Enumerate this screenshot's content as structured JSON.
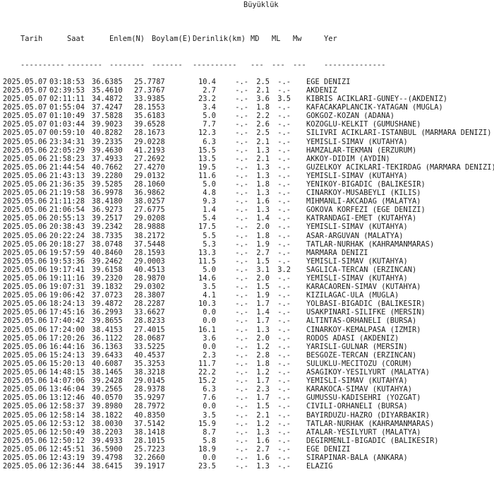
{
  "header": {
    "group_title": "Büyüklük",
    "columns": [
      "Tarih",
      "Saat",
      "Enlem(N)",
      "Boylam(E)",
      "Derinlik(km)",
      "MD",
      "ML",
      "Mw",
      "Yer"
    ],
    "separators": [
      "----------",
      "--------",
      "--------",
      "-------",
      "----------",
      "---",
      "---",
      "---",
      "--------------"
    ]
  },
  "rows": [
    [
      "2025.05.07",
      "03:18:53",
      "36.6385",
      "25.7787",
      "10.4",
      "-.-",
      "2.5",
      "-.-",
      "EGE DENIZI"
    ],
    [
      "2025.05.07",
      "02:39:53",
      "35.4610",
      "27.3767",
      "2.7",
      "-.-",
      "2.1",
      "-.-",
      "AKDENIZ"
    ],
    [
      "2025.05.07",
      "02:11:11",
      "34.4872",
      "33.9385",
      "23.2",
      "-.-",
      "3.6",
      "3.5",
      "KIBRIS ACIKLARI-GUNEY--(AKDENIZ)"
    ],
    [
      "2025.05.07",
      "01:55:04",
      "37.4247",
      "28.1553",
      "3.4",
      "-.-",
      "1.8",
      "-.-",
      "KAFACAKAPLANCIK-YATAGAN (MUGLA)"
    ],
    [
      "2025.05.07",
      "01:10:49",
      "37.5828",
      "35.6183",
      "5.0",
      "-.-",
      "2.2",
      "-.-",
      "GOKGOZ-KOZAN (ADANA)"
    ],
    [
      "2025.05.07",
      "01:03:44",
      "39.9023",
      "39.6528",
      "7.7",
      "-.-",
      "2.6",
      "-.-",
      "KOZOGLU-KELKIT (GUMUSHANE)"
    ],
    [
      "2025.05.07",
      "00:59:10",
      "40.8282",
      "28.1673",
      "12.3",
      "-.-",
      "2.5",
      "-.-",
      "SILIVRI ACIKLARI-ISTANBUL (MARMARA DENIZI)"
    ],
    [
      "2025.05.06",
      "23:34:31",
      "39.2335",
      "29.0228",
      "6.3",
      "-.-",
      "2.1",
      "-.-",
      "YEMISLI-SIMAV (KUTAHYA)"
    ],
    [
      "2025.05.06",
      "22:05:29",
      "39.4630",
      "41.2193",
      "15.5",
      "-.-",
      "1.3",
      "-.-",
      "HAMZALAR-TEKMAN (ERZURUM)"
    ],
    [
      "2025.05.06",
      "21:58:23",
      "37.4933",
      "27.2692",
      "13.5",
      "-.-",
      "2.1",
      "-.-",
      "AKKOY-DIDIM (AYDIN)"
    ],
    [
      "2025.05.06",
      "21:44:54",
      "40.7662",
      "27.4270",
      "19.5",
      "-.-",
      "1.3",
      "-.-",
      "GUZELKOY ACIKLARI-TEKIRDAG (MARMARA DENIZI)"
    ],
    [
      "2025.05.06",
      "21:43:13",
      "39.2280",
      "29.0132",
      "11.6",
      "-.-",
      "1.3",
      "-.-",
      "YEMISLI-SIMAV (KUTAHYA)"
    ],
    [
      "2025.05.06",
      "21:36:35",
      "39.5285",
      "28.1060",
      "5.0",
      "-.-",
      "1.8",
      "-.-",
      "YENIKOY-BIGADIC (BALIKESIR)"
    ],
    [
      "2025.05.06",
      "21:19:58",
      "36.9978",
      "36.9862",
      "4.8",
      "-.-",
      "1.3",
      "-.-",
      "CINARKOY-MUSABEYLI (KILIS)"
    ],
    [
      "2025.05.06",
      "21:11:28",
      "38.4180",
      "38.0257",
      "9.3",
      "-.-",
      "1.6",
      "-.-",
      "MIHMANLI-AKCADAG (MALATYA)"
    ],
    [
      "2025.05.06",
      "21:06:54",
      "36.9273",
      "27.6775",
      "1.4",
      "-.-",
      "1.3",
      "-.-",
      "GOKOVA KORFEZI (EGE DENIZI)"
    ],
    [
      "2025.05.06",
      "20:55:13",
      "39.2517",
      "29.0208",
      "5.4",
      "-.-",
      "1.4",
      "-.-",
      "KATRANDAGI-EMET (KUTAHYA)"
    ],
    [
      "2025.05.06",
      "20:38:43",
      "39.2342",
      "28.9888",
      "17.5",
      "-.-",
      "2.0",
      "-.-",
      "YEMISLI-SIMAV (KUTAHYA)"
    ],
    [
      "2025.05.06",
      "20:22:24",
      "38.7335",
      "38.2172",
      "5.5",
      "-.-",
      "1.8",
      "-.-",
      "ASAR-ARGUVAN (MALATYA)"
    ],
    [
      "2025.05.06",
      "20:18:27",
      "38.0748",
      "37.5448",
      "5.3",
      "-.-",
      "1.9",
      "-.-",
      "TATLAR-NURHAK (KAHRAMANMARAS)"
    ],
    [
      "2025.05.06",
      "19:57:59",
      "40.8460",
      "28.1593",
      "13.3",
      "-.-",
      "2.7",
      "-.-",
      "MARMARA DENIZI"
    ],
    [
      "2025.05.06",
      "19:53:36",
      "39.2462",
      "29.0003",
      "11.5",
      "-.-",
      "1.5",
      "-.-",
      "YEMISLI-SIMAV (KUTAHYA)"
    ],
    [
      "2025.05.06",
      "19:17:41",
      "39.6158",
      "40.4513",
      "5.0",
      "-.-",
      "3.1",
      "3.2",
      "SAGLICA-TERCAN (ERZINCAN)"
    ],
    [
      "2025.05.06",
      "19:11:16",
      "39.2320",
      "28.9870",
      "14.6",
      "-.-",
      "2.0",
      "-.-",
      "YEMISLI-SIMAV (KUTAHYA)"
    ],
    [
      "2025.05.06",
      "19:07:31",
      "39.1832",
      "29.0302",
      "3.5",
      "-.-",
      "1.5",
      "-.-",
      "KARACAOREN-SIMAV (KUTAHYA)"
    ],
    [
      "2025.05.06",
      "19:06:42",
      "37.0723",
      "28.3807",
      "4.1",
      "-.-",
      "1.9",
      "-.-",
      "KIZILAGAC-ULA (MUGLA)"
    ],
    [
      "2025.05.06",
      "18:24:13",
      "39.4872",
      "28.2287",
      "10.3",
      "-.-",
      "1.7",
      "-.-",
      "YOLBASI-BIGADIC (BALIKESIR)"
    ],
    [
      "2025.05.06",
      "17:45:16",
      "36.2993",
      "33.6627",
      "0.0",
      "-.-",
      "1.4",
      "-.-",
      "USAKPINARI-SILIFKE (MERSIN)"
    ],
    [
      "2025.05.06",
      "17:40:42",
      "39.8655",
      "28.8233",
      "0.0",
      "-.-",
      "1.7",
      "-.-",
      "ALTINTAS-ORHANELI (BURSA)"
    ],
    [
      "2025.05.06",
      "17:24:00",
      "38.4153",
      "27.4015",
      "16.1",
      "-.-",
      "1.3",
      "-.-",
      "CINARKOY-KEMALPASA (IZMIR)"
    ],
    [
      "2025.05.06",
      "17:20:26",
      "36.1122",
      "28.0687",
      "3.6",
      "-.-",
      "2.0",
      "-.-",
      "RODOS ADASI (AKDENIZ)"
    ],
    [
      "2025.05.06",
      "16:44:16",
      "36.1363",
      "33.5225",
      "0.0",
      "-.-",
      "1.2",
      "-.-",
      "YARISLI-GULNAR (MERSIN)"
    ],
    [
      "2025.05.06",
      "15:24:13",
      "39.6433",
      "40.4537",
      "2.3",
      "-.-",
      "2.8",
      "-.-",
      "BESGOZE-TERCAN (ERZINCAN)"
    ],
    [
      "2025.05.06",
      "15:20:13",
      "40.6087",
      "35.3253",
      "11.7",
      "-.-",
      "1.8",
      "-.-",
      "SULUKLU-MECITOZU (CORUM)"
    ],
    [
      "2025.05.06",
      "14:48:15",
      "38.1465",
      "38.3218",
      "22.2",
      "-.-",
      "1.2",
      "-.-",
      "ASAGIKOY-YESILYURT (MALATYA)"
    ],
    [
      "2025.05.06",
      "14:07:06",
      "39.2428",
      "29.0145",
      "15.2",
      "-.-",
      "1.7",
      "-.-",
      "YEMISLI-SIMAV (KUTAHYA)"
    ],
    [
      "2025.05.06",
      "13:46:04",
      "39.2565",
      "28.9378",
      "6.3",
      "-.-",
      "2.3",
      "-.-",
      "KARAKOCA-SIMAV (KUTAHYA)"
    ],
    [
      "2025.05.06",
      "13:12:46",
      "40.0570",
      "35.9297",
      "7.6",
      "-.-",
      "1.7",
      "-.-",
      "GUMUSSU-KADISEHRI (YOZGAT)"
    ],
    [
      "2025.05.06",
      "12:58:37",
      "39.8980",
      "28.7972",
      "0.0",
      "-.-",
      "1.5",
      "-.-",
      "CIVILI-ORHANELI (BURSA)"
    ],
    [
      "2025.05.06",
      "12:58:14",
      "38.1822",
      "40.8350",
      "3.5",
      "-.-",
      "2.1",
      "-.-",
      "BAYIRDUZU-HAZRO (DIYARBAKIR)"
    ],
    [
      "2025.05.06",
      "12:53:12",
      "38.0030",
      "37.5142",
      "15.9",
      "-.-",
      "1.2",
      "-.-",
      "TATLAR-NURHAK (KAHRAMANMARAS)"
    ],
    [
      "2025.05.06",
      "12:50:49",
      "38.2203",
      "38.1418",
      "8.7",
      "-.-",
      "1.3",
      "-.-",
      "ATALAR-YESILYURT (MALATYA)"
    ],
    [
      "2025.05.06",
      "12:50:12",
      "39.4933",
      "28.1015",
      "5.8",
      "-.-",
      "1.6",
      "-.-",
      "DEGIRMENLI-BIGADIC (BALIKESIR)"
    ],
    [
      "2025.05.06",
      "12:45:51",
      "36.5900",
      "25.7223",
      "18.9",
      "-.-",
      "2.7",
      "-.-",
      "EGE DENIZI"
    ],
    [
      "2025.05.06",
      "12:43:19",
      "39.4798",
      "32.2660",
      "0.0",
      "-.-",
      "1.6",
      "-.-",
      "SIRAPINAR-BALA (ANKARA)"
    ],
    [
      "2025.05.06",
      "12:36:44",
      "38.6415",
      "39.1917",
      "23.5",
      "-.-",
      "1.3",
      "-.-",
      "ELAZIG"
    ]
  ]
}
